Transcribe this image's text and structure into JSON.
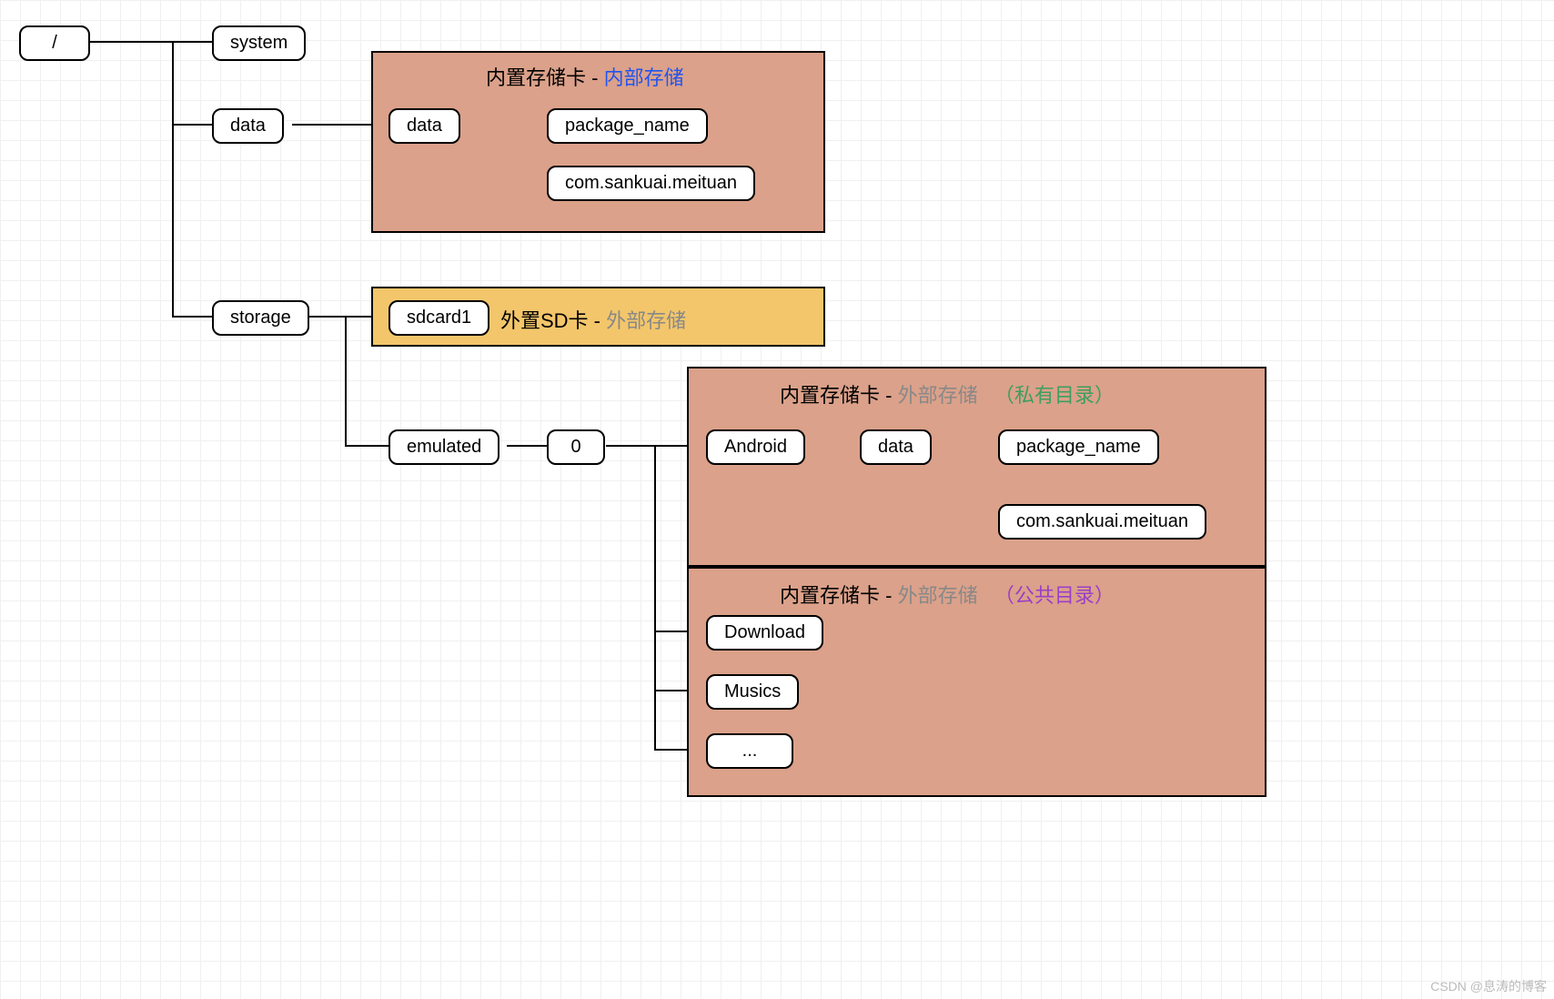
{
  "root": {
    "label": "/"
  },
  "level1": {
    "system": "system",
    "data": "data",
    "storage": "storage"
  },
  "internal": {
    "title_prefix": "内置存储卡 - ",
    "title_highlight": "内部存储",
    "data_node": "data",
    "package_name": "package_name",
    "example_pkg": "com.sankuai.meituan"
  },
  "sdcard": {
    "node": "sdcard1",
    "title_prefix": "外置SD卡 - ",
    "title_highlight": "外部存储"
  },
  "emulated": {
    "node": "emulated",
    "zero": "0"
  },
  "private_dir": {
    "title_prefix": "内置存储卡 - ",
    "title_mid": "外部存储",
    "title_suffix": "（私有目录）",
    "android": "Android",
    "data": "data",
    "package_name": "package_name",
    "example_pkg": "com.sankuai.meituan"
  },
  "public_dir": {
    "title_prefix": "内置存储卡 - ",
    "title_mid": "外部存储",
    "title_suffix": "（公共目录）",
    "download": "Download",
    "musics": "Musics",
    "more": "..."
  },
  "watermark": "CSDN @息涛的博客"
}
